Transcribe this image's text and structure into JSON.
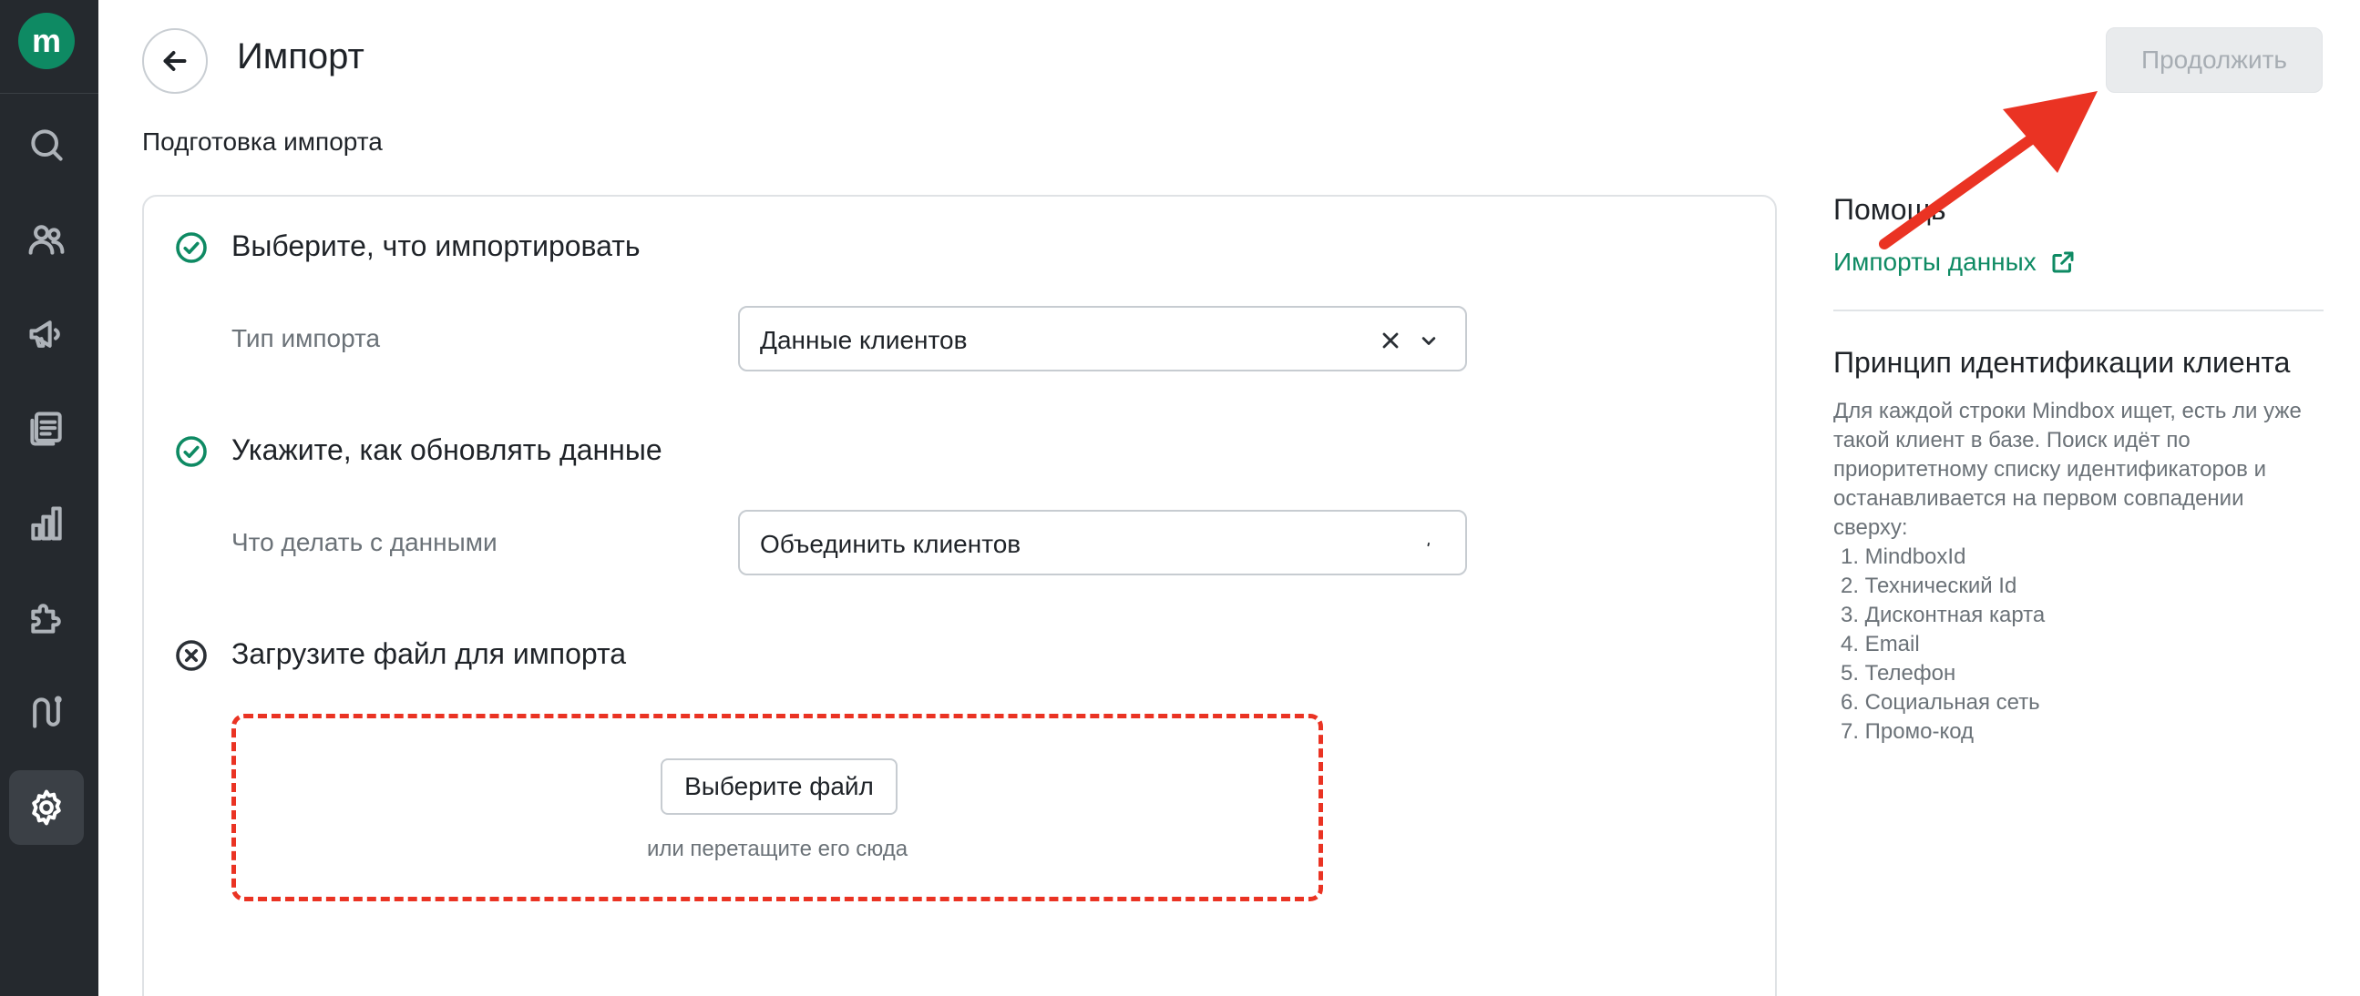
{
  "app": {
    "logo_letter": "m",
    "accent": "#0e8a63"
  },
  "sidebar": {
    "items": [
      {
        "name": "search",
        "icon": "search-icon",
        "active": false
      },
      {
        "name": "clients",
        "icon": "users-icon",
        "active": false
      },
      {
        "name": "campaigns",
        "icon": "megaphone-icon",
        "active": false
      },
      {
        "name": "content",
        "icon": "document-icon",
        "active": false
      },
      {
        "name": "analytics",
        "icon": "bar-chart-icon",
        "active": false
      },
      {
        "name": "integrations",
        "icon": "puzzle-icon",
        "active": false
      },
      {
        "name": "scenarios",
        "icon": "route-icon",
        "active": false
      },
      {
        "name": "settings",
        "icon": "gear-icon",
        "active": true
      }
    ]
  },
  "header": {
    "title": "Импорт",
    "continue_label": "Продолжить"
  },
  "subtitle": "Подготовка импорта",
  "steps": [
    {
      "status": "done",
      "title": "Выберите, что импортировать",
      "field_label": "Тип импорта",
      "value": "Данные клиентов"
    },
    {
      "status": "done",
      "title": "Укажите, как обновлять данные",
      "field_label": "Что делать с данными",
      "value": "Объединить клиентов"
    },
    {
      "status": "error",
      "title": "Загрузите файл для импорта"
    }
  ],
  "upload": {
    "button_label": "Выберите файл",
    "hint": "или перетащите его сюда"
  },
  "help": {
    "title": "Помощь",
    "link_label": "Импорты данных",
    "ident_title": "Принцип идентификации клиента",
    "ident_text": "Для каждой строки Mindbox ищет, есть ли уже такой клиент в базе. Поиск идёт по приоритетному списку идентификаторов и останавливается на первом совпадении сверху:",
    "ident_list": [
      "1. MindboxId",
      "2. Технический Id",
      "3. Дисконтная карта",
      "4. Email",
      "5. Телефон",
      "6. Социальная сеть",
      "7. Промо-код"
    ]
  },
  "colors": {
    "annotation": "#ea3323",
    "success": "#0e8a63",
    "sidebar_bg": "#25292e"
  }
}
